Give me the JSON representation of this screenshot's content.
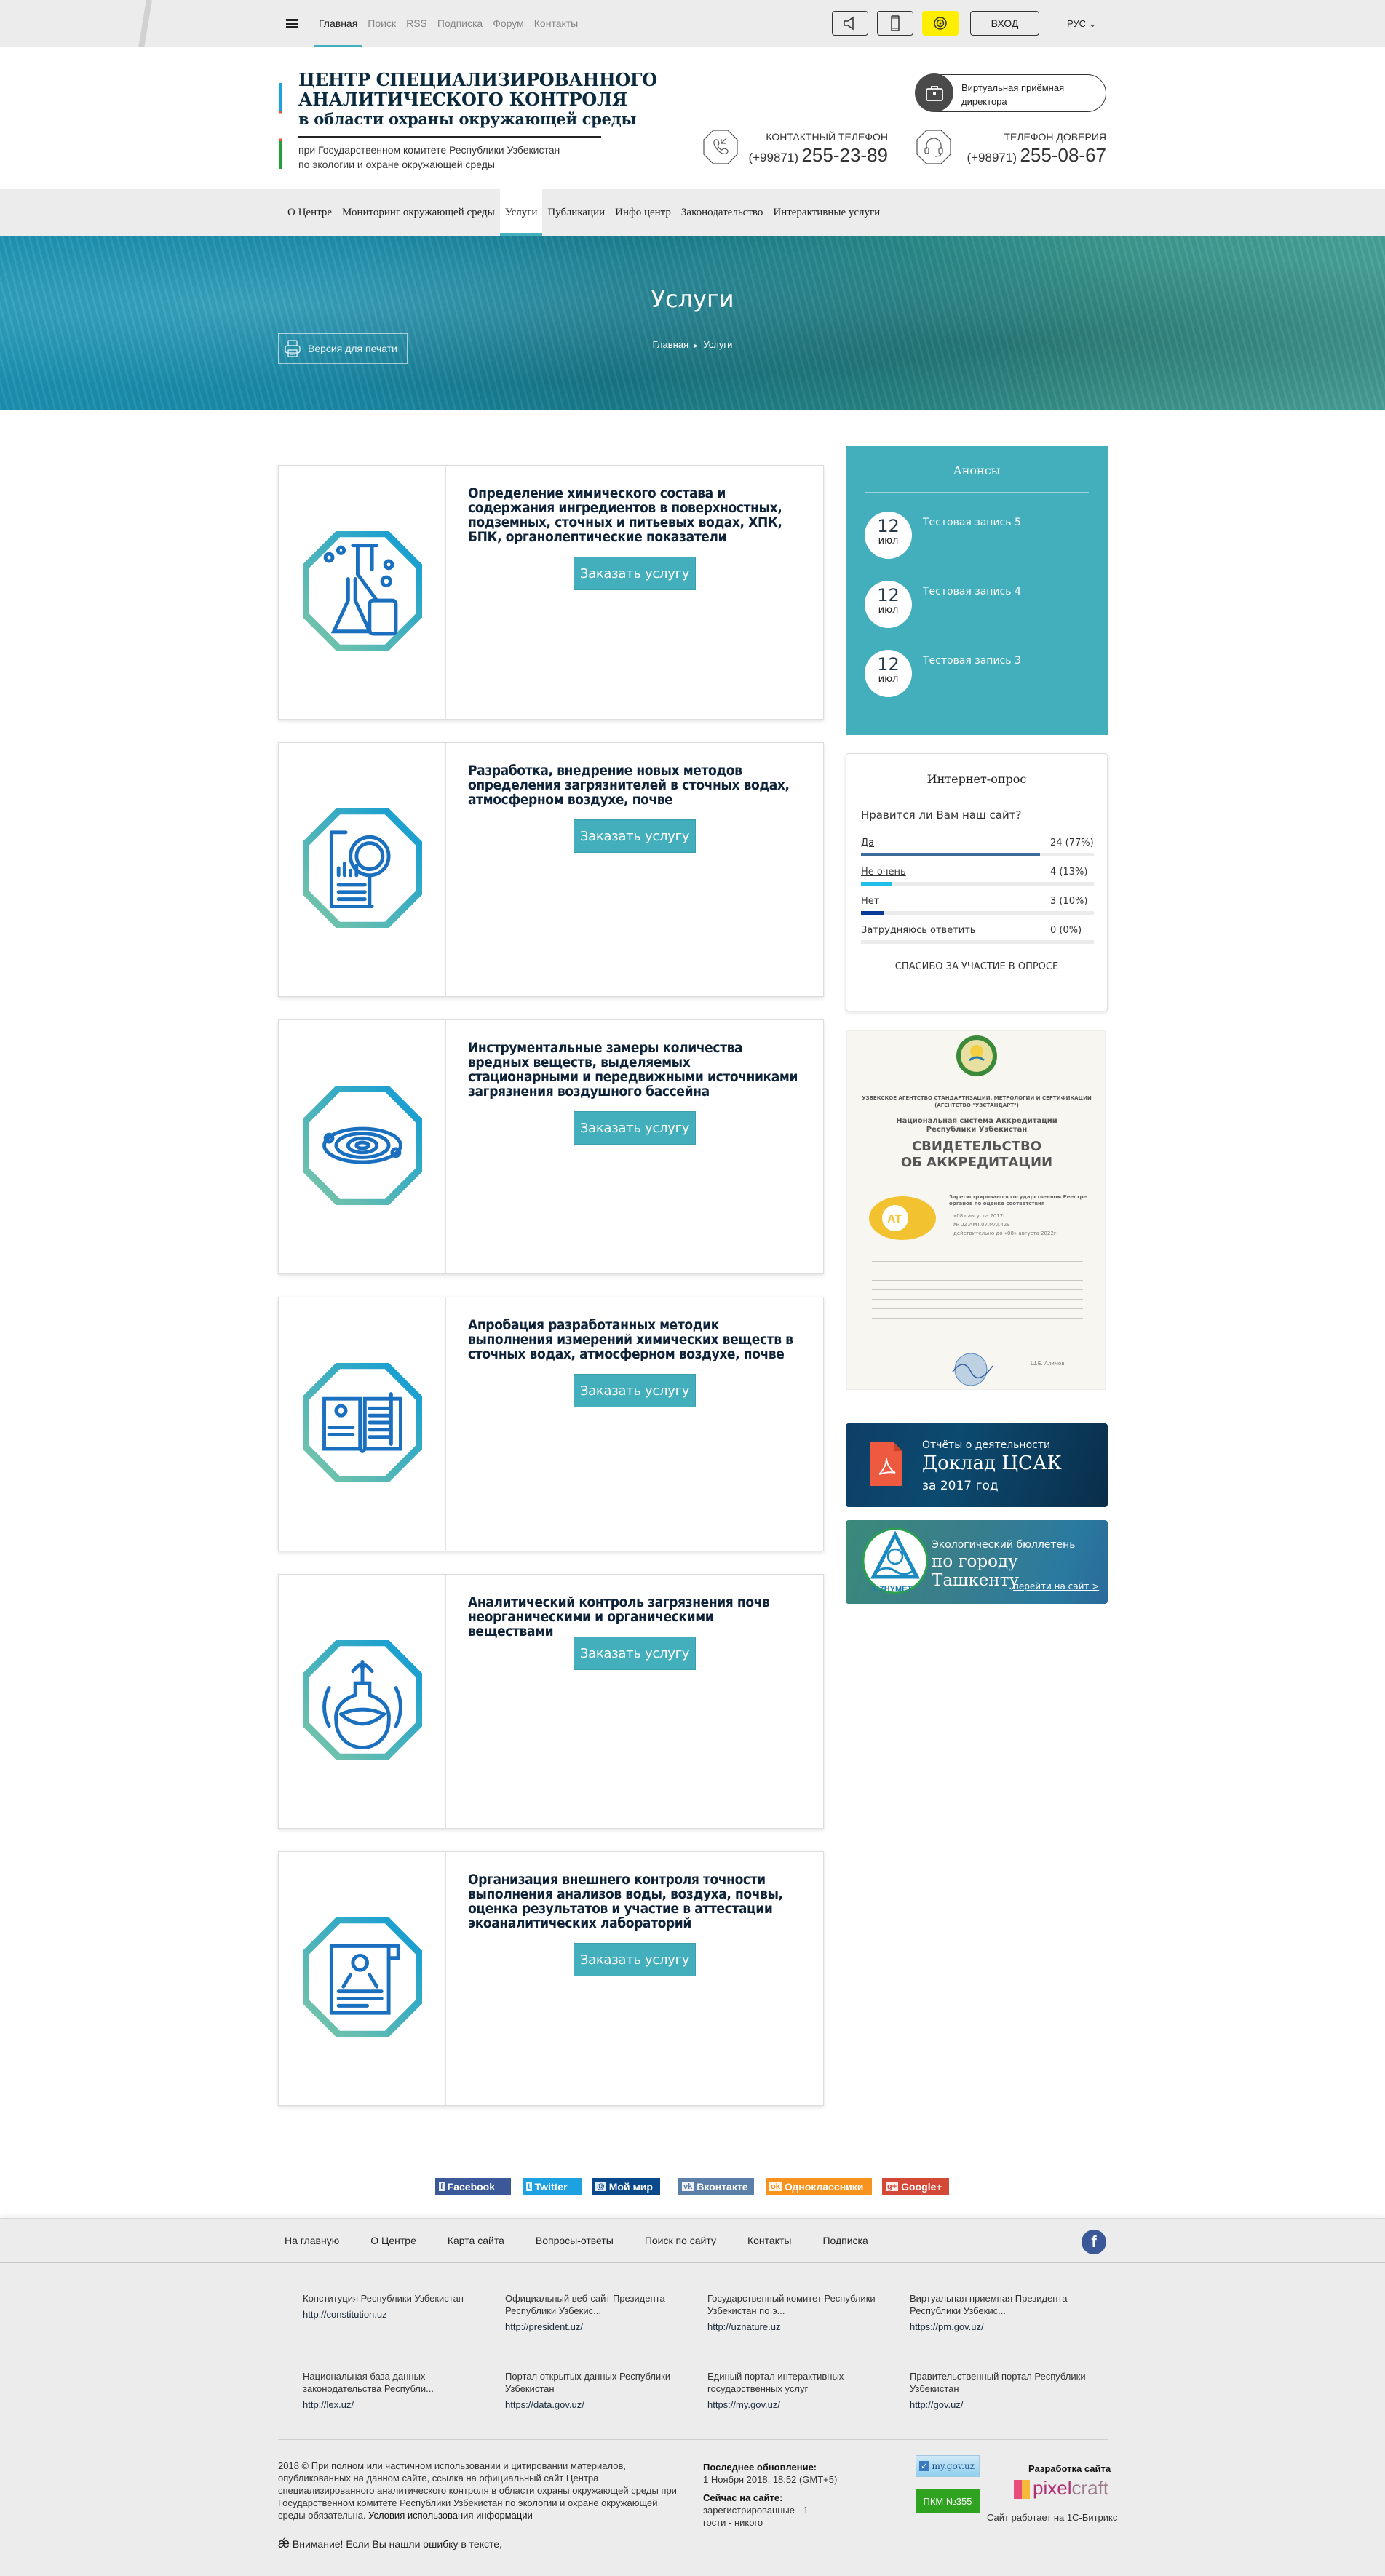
{
  "topbar": {
    "links": [
      "Главная",
      "Поиск",
      "RSS",
      "Подписка",
      "Форум",
      "Контакты"
    ],
    "active_link": "Главная",
    "login_label": "ВХОД",
    "language": "РУС"
  },
  "header": {
    "title_line1": "ЦЕНТР СПЕЦИАЛИЗИРОВАННОГО",
    "title_line2": "АНАЛИТИЧЕСКОГО КОНТРОЛЯ",
    "title_line3": "в области охраны окружающей среды",
    "desc_line1": "при Государственном комитете Республики Узбекистан",
    "desc_line2": "по экологии и охране окружающей среды",
    "virtual_reception_line1": "Виртуальная приёмная",
    "virtual_reception_line2": "директора",
    "contact_phone": {
      "label": "КОНТАКТНЫЙ ТЕЛЕФОН",
      "prefix": "(+99871)",
      "number": "255-23-89"
    },
    "trust_phone": {
      "label": "ТЕЛЕФОН ДОВЕРИЯ",
      "prefix": "(+98971)",
      "number": "255-08-67"
    }
  },
  "nav": {
    "items": [
      "О Центре",
      "Мониторинг окружающей среды",
      "Услуги",
      "Публикации",
      "Инфо центр",
      "Законодательство",
      "Интерактивные услуги"
    ],
    "active": "Услуги"
  },
  "hero": {
    "title": "Услуги",
    "breadcrumb": [
      "Главная",
      "Услуги"
    ],
    "breadcrumb_separator": "▸",
    "print_label": "Версия для печати"
  },
  "services": {
    "order_label": "Заказать услугу",
    "items": [
      {
        "icon": "chemistry-flasks-icon",
        "title": "Определение химического состава и содержания ингредиентов в поверхностных, подземных, сточных и питьевых водах, ХПК, БПК, органолептические показатели"
      },
      {
        "icon": "document-magnifier-icon",
        "title": "Разработка, внедрение новых методов определения загрязнителей в сточных водах, атмосферном воздухе, почве"
      },
      {
        "icon": "orbit-rings-icon",
        "title": "Инструментальные замеры количества вредных веществ, выделяемых стационарными и передвижными источниками загрязнения воздушного бассейна"
      },
      {
        "icon": "open-book-icon",
        "title": "Апробация разработанных методик выполнения измерений химических веществ в сточных водах, атмосферном воздухе, почве"
      },
      {
        "icon": "plant-flask-icon",
        "title": "Аналитический контроль загрязнения почв неорганическими и органическими веществами"
      },
      {
        "icon": "certificate-scroll-icon",
        "title": "Организация внешнего контроля точности выполнения анализов воды, воздуха, почвы, оценка результатов и участие в аттестации экоаналитических лабораторий"
      }
    ]
  },
  "sidebar": {
    "announcements": {
      "title": "Анонсы",
      "items": [
        {
          "day": "12",
          "month": "июл",
          "title": "Тестовая запись 5"
        },
        {
          "day": "12",
          "month": "июл",
          "title": "Тестовая запись 4"
        },
        {
          "day": "12",
          "month": "июл",
          "title": "Тестовая запись 3"
        }
      ]
    },
    "poll": {
      "title": "Интернет-опрос",
      "question": "Нравится ли Вам наш сайт?",
      "options": [
        {
          "label": "Да",
          "value": "24 (77%)",
          "percent": 77,
          "color": "#3a6b9a"
        },
        {
          "label": "Не очень",
          "value": "4 (13%)",
          "percent": 13,
          "color": "#1ec0ea"
        },
        {
          "label": "Нет",
          "value": "3 (10%)",
          "percent": 10,
          "color": "#0a3a9a"
        },
        {
          "label": "Затрудняюсь ответить",
          "value": "0 (0%)",
          "percent": 0,
          "color": "#3a6b9a"
        }
      ],
      "thanks": "СПАСИБО ЗА УЧАСТИЕ В ОПРОСЕ"
    },
    "certificate": {
      "agency": "УЗБЕКСКОЕ АГЕНТСТВО СТАНДАРТИЗАЦИИ, МЕТРОЛОГИИ И СЕРТИФИКАЦИИ",
      "agency_short": "(АГЕНТСТВО \"УЗСТАНДАРТ\")",
      "system": "Национальная система Аккредитации Республики Узбекистан",
      "title_line1": "СВИДЕТЕЛЬСТВО",
      "title_line2": "ОБ АККРЕДИТАЦИИ",
      "registered": "Зарегистрировано в государственном Реестре органов по оценке соответствия",
      "date": "«08» августа 2017г.",
      "number": "№ UZ.AMT.07.MAI.429",
      "valid": "действительно до «08» августа 2022г.",
      "signer": "Ш.Б. Алимов"
    },
    "report_banner": {
      "line1": "Отчёты о деятельности",
      "line2": "Доклад ЦСАК",
      "line3": "за 2017 год"
    },
    "bulletin_banner": {
      "line1": "Экологический бюллетень",
      "line2": "по городу Ташкенту",
      "link": "перейти на сайт >",
      "logo_text": "UZHYMET"
    }
  },
  "share": [
    {
      "label": "Facebook",
      "icon": "f",
      "color": "#3b5998"
    },
    {
      "label": "Twitter",
      "icon": "t",
      "color": "#1da1e0"
    },
    {
      "label": "Мой мир",
      "icon": "@",
      "color": "#0a4a8a"
    },
    {
      "label": "Вконтакте",
      "icon": "vk",
      "color": "#5b7fa6"
    },
    {
      "label": "Одноклассники",
      "icon": "ok",
      "color": "#f7931e"
    },
    {
      "label": "Google+",
      "icon": "g+",
      "color": "#d34836"
    }
  ],
  "footer": {
    "links": [
      "На главную",
      "О Центре",
      "Карта сайта",
      "Вопросы-ответы",
      "Поиск по сайту",
      "Контакты",
      "Подписка"
    ],
    "useful_links": [
      {
        "title": "Конституция Республики Узбекистан",
        "url": "http://constitution.uz"
      },
      {
        "title": "Официальный веб-сайт Президента Республики Узбекис...",
        "url": "http://president.uz/"
      },
      {
        "title": "Государственный комитет Республики Узбекистан по э...",
        "url": "http://uznature.uz"
      },
      {
        "title": "Виртуальная приемная Президента Республики Узбекис...",
        "url": "https://pm.gov.uz/"
      },
      {
        "title": "Национальная база данных законодательства Республи...",
        "url": "http://lex.uz/"
      },
      {
        "title": "Портал открытых данных Республики Узбекистан",
        "url": "https://data.gov.uz/"
      },
      {
        "title": "Единый портал интерактивных государственных услуг",
        "url": "https://my.gov.uz/"
      },
      {
        "title": "Правительственный портал Республики Узбекистан",
        "url": "http://gov.uz/"
      }
    ],
    "copyright": "2018 © При полном или частичном использовании и цитировании материалов, опубликованных на данном сайте, ссылка на официальный сайт Центра специализированного аналитического контроля в области охраны окружающей среды при Государственном комитете Республики Узбекистан по экологии и охране окружающей среды обязательна.",
    "terms_link": "Условия использования информации",
    "warning": "Внимание! Если Вы нашли ошибку в тексте,",
    "last_update_label": "Последнее обновление:",
    "last_update_value": "1 Ноября 2018, 18:52 (GMT+5)",
    "online_label": "Сейчас на сайте:",
    "online_registered": "зарегистрированные - 1",
    "online_guests": "гости - никого",
    "badge_mygov": "my.gov.uz",
    "badge_pkm": "ПКМ №355",
    "developer_label": "Разработка сайта",
    "developer_name_a": "pixel",
    "developer_name_b": "craft",
    "engine": "Сайт работает на 1С-Битрикс"
  }
}
